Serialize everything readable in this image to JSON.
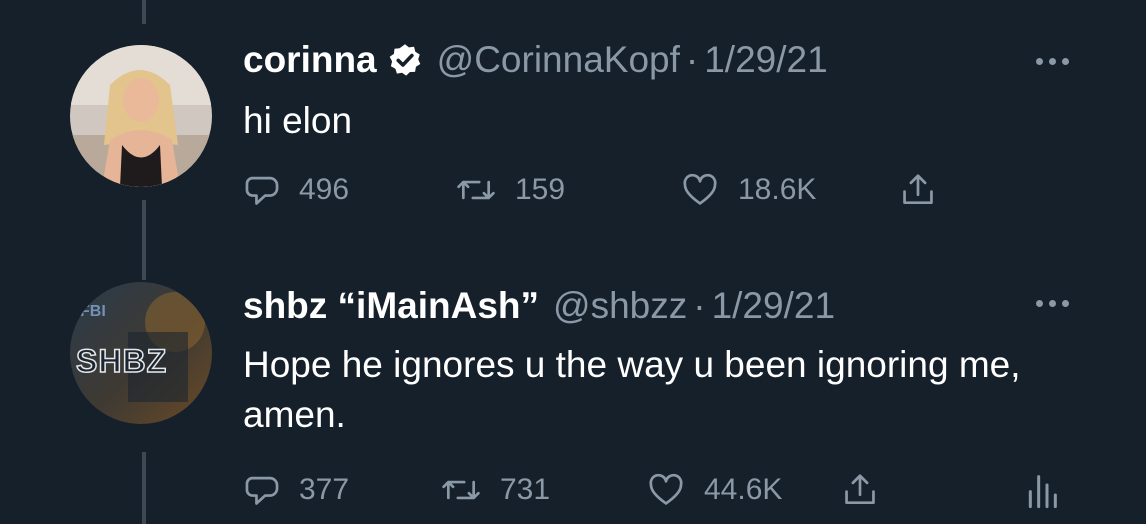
{
  "tweets": [
    {
      "display_name": "corinna",
      "verified": true,
      "handle": "@CorinnaKopf",
      "separator": "·",
      "date": "1/29/21",
      "text": "hi elon",
      "replies": "496",
      "retweets": "159",
      "likes": "18.6K",
      "avatar_icon": "profile-photo",
      "more_icon": "ellipsis-icon"
    },
    {
      "display_name": "shbz “iMainAsh”",
      "verified": false,
      "handle": "@shbzz",
      "separator": "·",
      "date": "1/29/21",
      "text": "Hope he ignores u the way u been ignoring me, amen.",
      "replies": "377",
      "retweets": "731",
      "likes": "44.6K",
      "avatar_text": "SHBZ",
      "avatar_badge": "FBI",
      "more_icon": "ellipsis-icon",
      "analytics_icon": "analytics-icon"
    }
  ],
  "colors": {
    "background": "#15202b",
    "text": "#ffffff",
    "muted": "#8b98a5",
    "thread_line": "#3d4854"
  }
}
